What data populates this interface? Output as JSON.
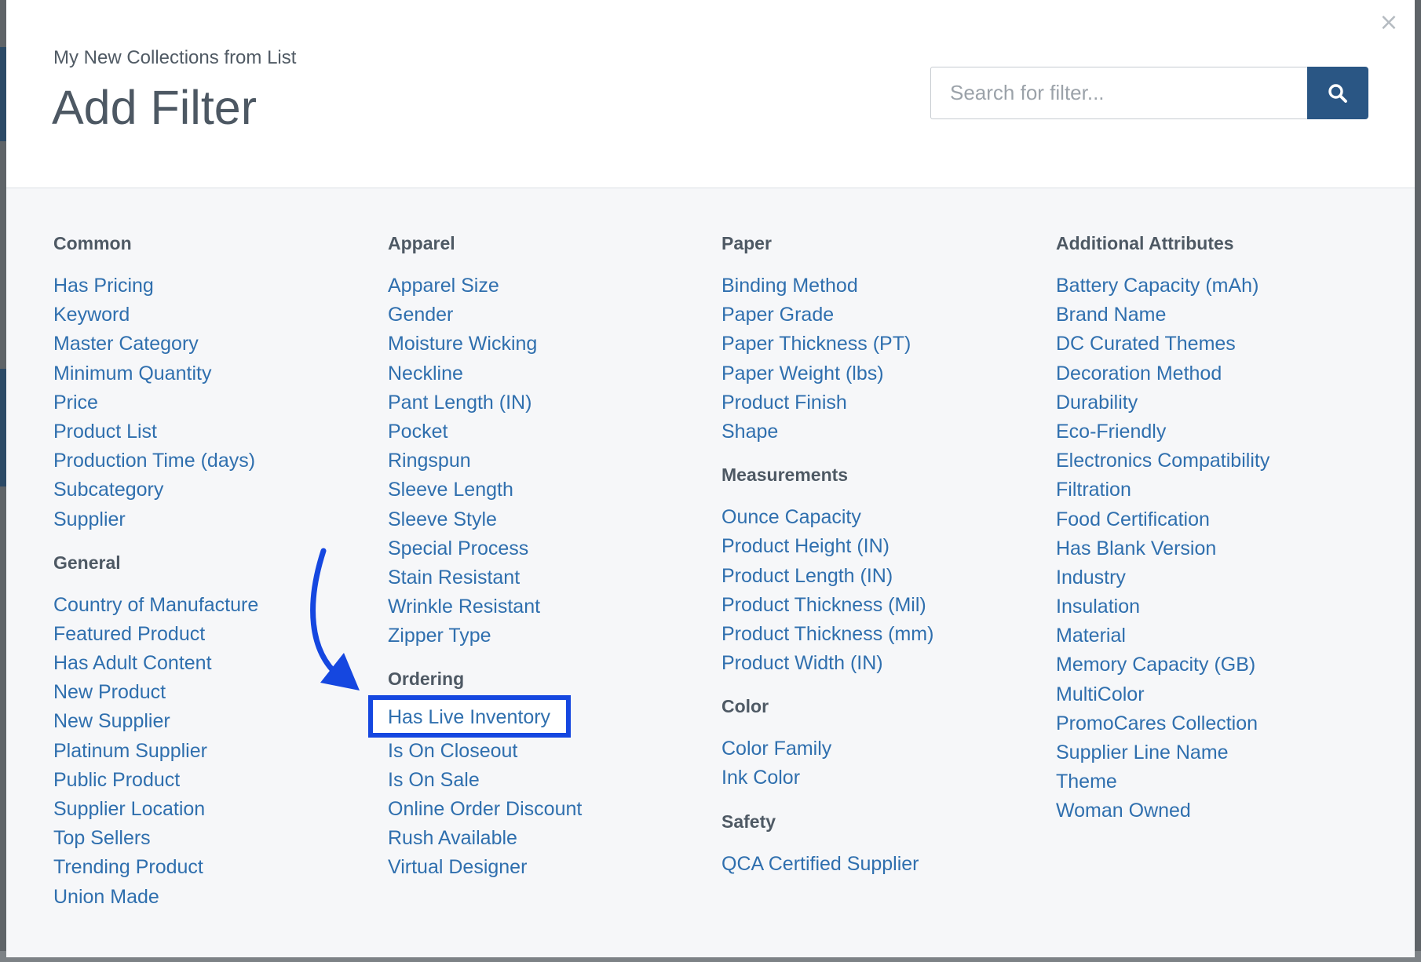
{
  "modal": {
    "subtitle": "My New Collections from List",
    "title": "Add Filter",
    "close_glyph": "×",
    "search": {
      "placeholder": "Search for filter...",
      "value": "",
      "icon": "search-icon"
    }
  },
  "highlight": {
    "label": "Has Live Inventory",
    "color": "#1547e0",
    "arrow_icon": "curved-arrow-icon"
  },
  "columns": [
    {
      "groups": [
        {
          "title": "Common",
          "items": [
            "Has Pricing",
            "Keyword",
            "Master Category",
            "Minimum Quantity",
            "Price",
            "Product List",
            "Production Time (days)",
            "Subcategory",
            "Supplier"
          ]
        },
        {
          "title": "General",
          "items": [
            "Country of Manufacture",
            "Featured Product",
            "Has Adult Content",
            "New Product",
            "New Supplier",
            "Platinum Supplier",
            "Public Product",
            "Supplier Location",
            "Top Sellers",
            "Trending Product",
            "Union Made"
          ]
        }
      ]
    },
    {
      "groups": [
        {
          "title": "Apparel",
          "items": [
            "Apparel Size",
            "Gender",
            "Moisture Wicking",
            "Neckline",
            "Pant Length (IN)",
            "Pocket",
            "Ringspun",
            "Sleeve Length",
            "Sleeve Style",
            "Special Process",
            "Stain Resistant",
            "Wrinkle Resistant",
            "Zipper Type"
          ]
        },
        {
          "title": "Ordering",
          "items": [
            "Has Live Inventory",
            "Is On Closeout",
            "Is On Sale",
            "Online Order Discount",
            "Rush Available",
            "Virtual Designer"
          ]
        }
      ]
    },
    {
      "groups": [
        {
          "title": "Paper",
          "items": [
            "Binding Method",
            "Paper Grade",
            "Paper Thickness (PT)",
            "Paper Weight (lbs)",
            "Product Finish",
            "Shape"
          ]
        },
        {
          "title": "Measurements",
          "items": [
            "Ounce Capacity",
            "Product Height (IN)",
            "Product Length (IN)",
            "Product Thickness (Mil)",
            "Product Thickness (mm)",
            "Product Width (IN)"
          ]
        },
        {
          "title": "Color",
          "items": [
            "Color Family",
            "Ink Color"
          ]
        },
        {
          "title": "Safety",
          "items": [
            "QCA Certified Supplier"
          ]
        }
      ]
    },
    {
      "groups": [
        {
          "title": "Additional Attributes",
          "items": [
            "Battery Capacity (mAh)",
            "Brand Name",
            "DC Curated Themes",
            "Decoration Method",
            "Durability",
            "Eco-Friendly",
            "Electronics Compatibility",
            "Filtration",
            "Food Certification",
            "Has Blank Version",
            "Industry",
            "Insulation",
            "Material",
            "Memory Capacity (GB)",
            "MultiColor",
            "PromoCares Collection",
            "Supplier Line Name",
            "Theme",
            "Woman Owned"
          ]
        }
      ]
    }
  ]
}
